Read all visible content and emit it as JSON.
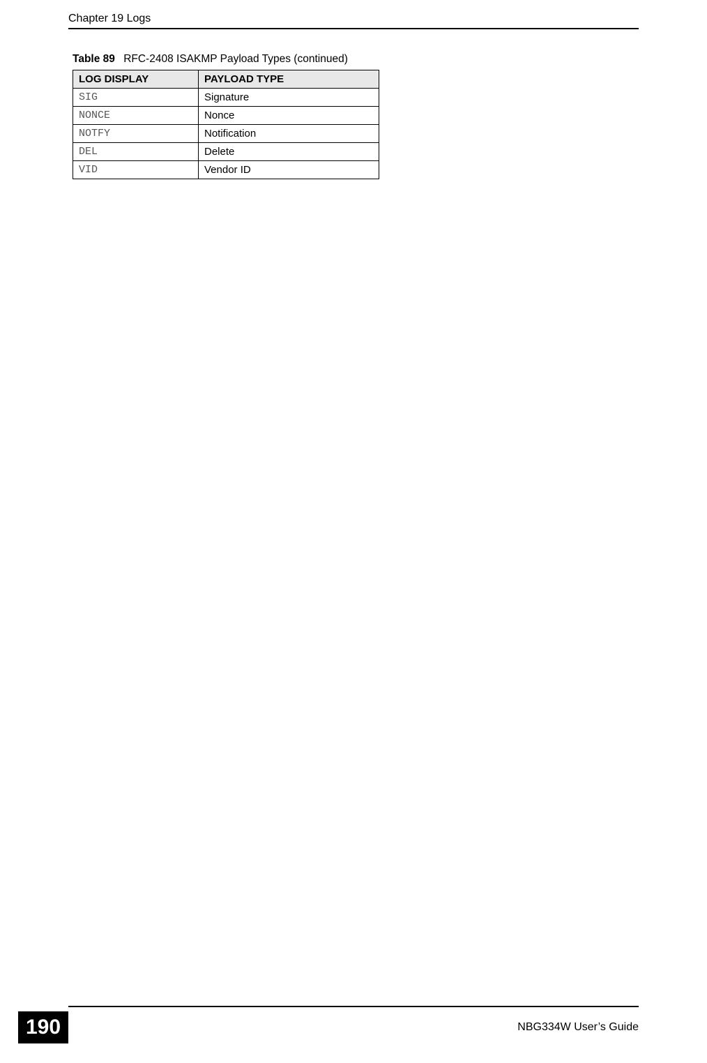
{
  "header": {
    "chapter_title": "Chapter 19 Logs"
  },
  "table": {
    "caption_number": "Table 89",
    "caption_title": "RFC-2408 ISAKMP Payload Types (continued)",
    "columns": {
      "log_display": "LOG DISPLAY",
      "payload_type": "PAYLOAD TYPE"
    },
    "rows": [
      {
        "log": "SIG",
        "type": "Signature"
      },
      {
        "log": "NONCE",
        "type": "Nonce"
      },
      {
        "log": "NOTFY",
        "type": "Notification"
      },
      {
        "log": "DEL",
        "type": "Delete"
      },
      {
        "log": "VID",
        "type": "Vendor ID"
      }
    ]
  },
  "footer": {
    "page_number": "190",
    "guide_name": "NBG334W User’s Guide"
  }
}
